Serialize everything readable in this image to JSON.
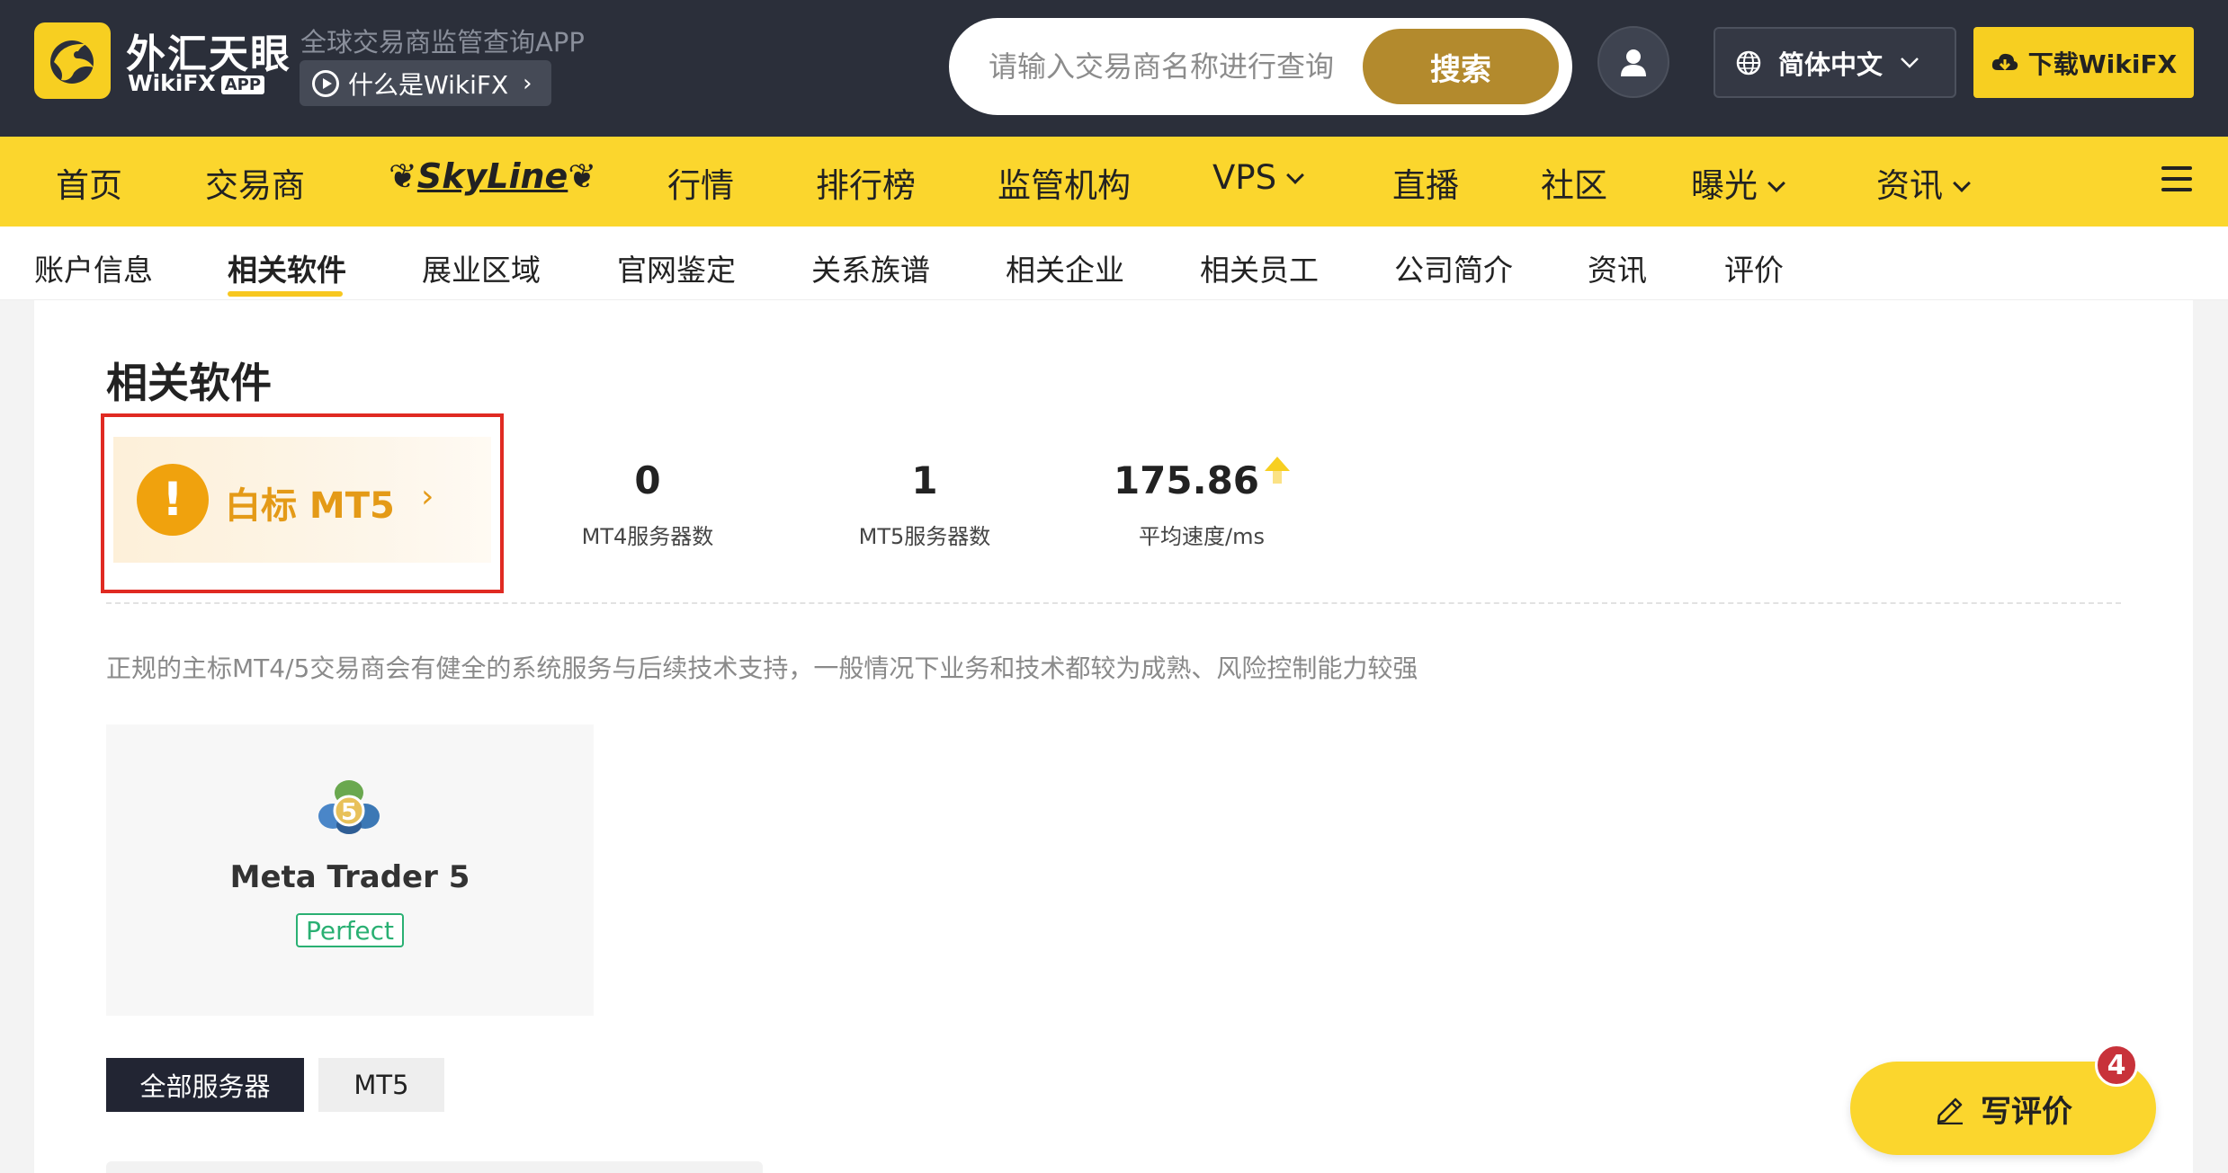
{
  "header": {
    "brand_cn": "外汇天眼",
    "brand_en": "WikiFX",
    "brand_app": "APP",
    "tagline": "全球交易商监管查询APP",
    "whatis_label": "什么是WikiFX",
    "search_placeholder": "请输入交易商名称进行查询",
    "search_button": "搜索",
    "language": "简体中文",
    "download": "下载WikiFX"
  },
  "nav": {
    "items": [
      "首页",
      "交易商",
      "SkyLine",
      "行情",
      "排行榜",
      "监管机构",
      "VPS",
      "直播",
      "社区",
      "曝光",
      "资讯"
    ]
  },
  "subtabs": {
    "items": [
      "账户信息",
      "相关软件",
      "展业区域",
      "官网鉴定",
      "关系族谱",
      "相关企业",
      "相关员工",
      "公司简介",
      "资讯",
      "评价"
    ],
    "active": "相关软件"
  },
  "main": {
    "title": "相关软件",
    "badge": "白标 MT5",
    "stats": [
      {
        "value": "0",
        "label": "MT4服务器数"
      },
      {
        "value": "1",
        "label": "MT5服务器数"
      },
      {
        "value": "175.86",
        "label": "平均速度/ms"
      }
    ],
    "description": "正规的主标MT4/5交易商会有健全的系统服务与后续技术支持，一般情况下业务和技术都较为成熟、风险控制能力较强",
    "software": {
      "name": "Meta Trader 5",
      "status": "Perfect",
      "logo_digit": "5"
    },
    "filters": [
      "全部服务器",
      "MT5"
    ]
  },
  "review": {
    "label": "写评价",
    "count": "4"
  },
  "colors": {
    "brand_yellow": "#fbd62d",
    "header_dark": "#2b2f3a",
    "warning_orange": "#f0a20d",
    "perfect_green": "#2ab073",
    "highlight_red": "#e02a22"
  }
}
